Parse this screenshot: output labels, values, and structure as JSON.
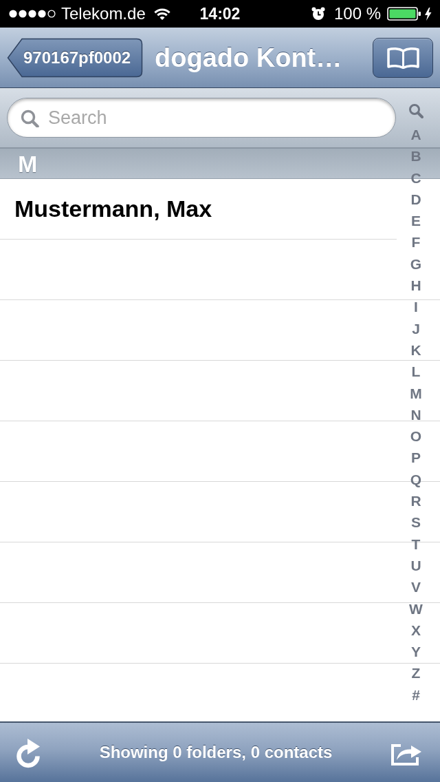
{
  "status_bar": {
    "carrier": "Telekom.de",
    "time": "14:02",
    "battery": "100 %"
  },
  "nav_bar": {
    "back_button": "970167pf0002",
    "title": "dogado Kont…"
  },
  "search": {
    "placeholder": "Search"
  },
  "sections": [
    {
      "header": "M",
      "rows": [
        {
          "name": "Mustermann, Max"
        }
      ]
    }
  ],
  "index": [
    "A",
    "B",
    "C",
    "D",
    "E",
    "F",
    "G",
    "H",
    "I",
    "J",
    "K",
    "L",
    "M",
    "N",
    "O",
    "P",
    "Q",
    "R",
    "S",
    "T",
    "U",
    "V",
    "W",
    "X",
    "Y",
    "Z",
    "#"
  ],
  "toolbar": {
    "status": "Showing 0 folders, 0 contacts"
  }
}
